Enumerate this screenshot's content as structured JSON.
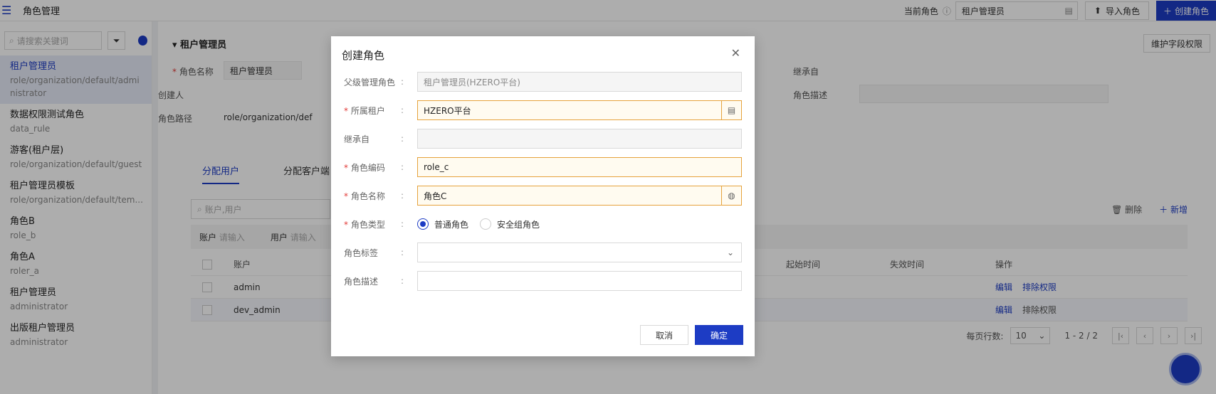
{
  "topbar": {
    "title": "角色管理",
    "current_role_label": "当前角色",
    "current_role_value": "租户管理员",
    "import_label": "导入角色",
    "create_label": "创建角色"
  },
  "sidebar": {
    "search_placeholder": "请搜索关键词",
    "items": [
      {
        "name": "租户管理员",
        "path": "role/organization/default/administrator"
      },
      {
        "name": "数据权限测试角色",
        "path": "data_rule"
      },
      {
        "name": "游客(租户层)",
        "path": "role/organization/default/guest"
      },
      {
        "name": "租户管理员模板",
        "path": "role/organization/default/tem..."
      },
      {
        "name": "角色B",
        "path": "role_b"
      },
      {
        "name": "角色A",
        "path": "roler_a"
      },
      {
        "name": "租户管理员",
        "path": "administrator"
      },
      {
        "name": "出版租户管理员",
        "path": "administrator"
      }
    ]
  },
  "main": {
    "section_title": "租户管理员",
    "field_perm_label": "维护字段权限",
    "role_name_label": "角色名称",
    "role_name_value": "租户管理员",
    "creator_label": "创建人",
    "role_path_label": "角色路径",
    "role_path_value": "role/organization/def",
    "inherit_label": "继承自",
    "desc_label": "角色描述",
    "tabs": [
      "分配用户",
      "分配客户端"
    ],
    "table_search_placeholder": "账户,用户",
    "query_account_label": "账户",
    "query_account_ph": "请输入",
    "query_user_label": "用户",
    "query_user_ph": "请输入",
    "delete_label": "删除",
    "add_label": "新增",
    "columns": {
      "account": "账户",
      "start": "起始时间",
      "end": "失效时间",
      "ops": "操作"
    },
    "rows": [
      {
        "account": "admin",
        "edit": "编辑",
        "remove": "排除权限"
      },
      {
        "account": "dev_admin",
        "edit": "编辑",
        "remove": "排除权限"
      }
    ],
    "pager": {
      "rows_label": "每页行数:",
      "rows_value": "10",
      "range": "1 - 2 / 2"
    }
  },
  "modal": {
    "title": "创建角色",
    "fields": {
      "parent_label": "父级管理角色",
      "parent_value": "租户管理员(HZERO平台)",
      "tenant_label": "所属租户",
      "tenant_value": "HZERO平台",
      "inherit_label": "继承自",
      "inherit_value": "",
      "code_label": "角色编码",
      "code_value": "role_c",
      "name_label": "角色名称",
      "name_value": "角色C",
      "type_label": "角色类型",
      "type_normal": "普通角色",
      "type_security": "安全组角色",
      "tag_label": "角色标签",
      "tag_value": "",
      "desc_label": "角色描述",
      "desc_value": ""
    },
    "cancel_label": "取消",
    "ok_label": "确定"
  },
  "colors": {
    "primary": "#1d3cc4",
    "required_border": "#e6a23c"
  }
}
